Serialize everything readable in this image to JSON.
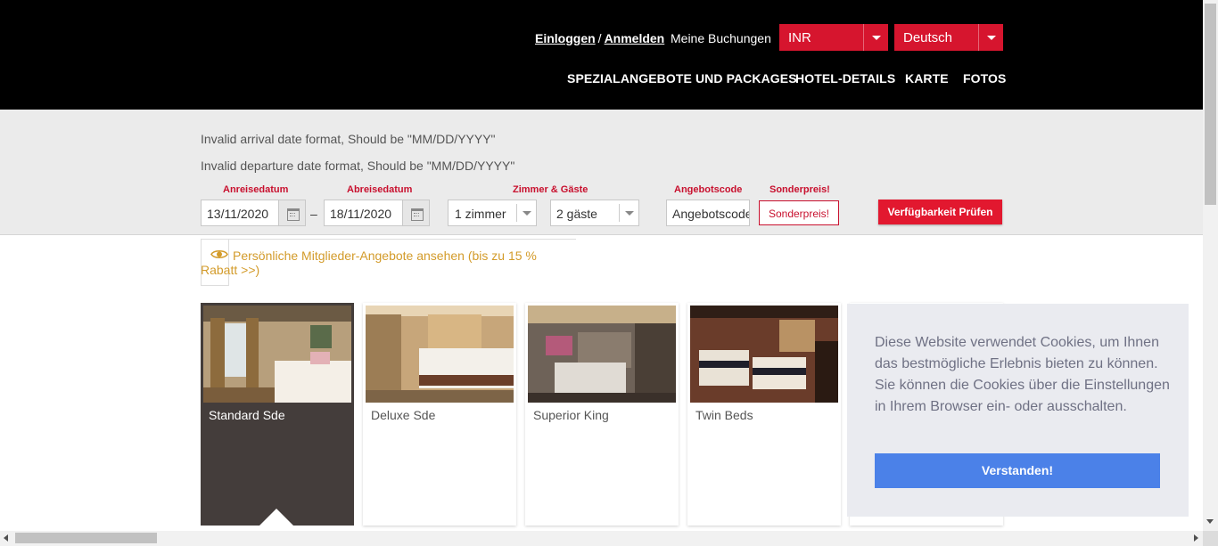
{
  "header": {
    "login": "Einloggen",
    "separator": "/",
    "register": "Anmelden",
    "bookings": "Meine Buchungen",
    "currency": "INR",
    "language": "Deutsch",
    "nav": [
      "SPEZIALANGEBOTE UND PACKAGES",
      "HOTEL-DETAILS",
      "KARTE",
      "FOTOS"
    ]
  },
  "search": {
    "errors": [
      "Invalid arrival date format, Should be \"MM/DD/YYYY\"",
      "Invalid departure date format, Should be \"MM/DD/YYYY\""
    ],
    "arrival_label": "Anreisedatum",
    "arrival_value": "13/11/2020",
    "departure_label": "Abreisedatum",
    "departure_value": "18/11/2020",
    "range_dash": "–",
    "rooms_guests_label": "Zimmer & Gäste",
    "rooms_value": "1 zimmer",
    "guests_value": "2 gäste",
    "promo_label": "Angebotscode",
    "promo_placeholder": "Angebotscode",
    "special_label": "Sonderpreis!",
    "special_button": "Sonderpreis!",
    "check_button": "Verfügbarkeit Prüfen"
  },
  "member_banner": "Persönliche Mitglieder-Angebote ansehen (bis zu 15 % Rabatt >>)",
  "rooms": [
    {
      "name": "Standard Sde",
      "active": true
    },
    {
      "name": "Deluxe Sde",
      "active": false
    },
    {
      "name": "Superior King",
      "active": false
    },
    {
      "name": "Twin Beds",
      "active": false
    }
  ],
  "cookie": {
    "text": "Diese Website verwendet Cookies, um Ihnen das bestmögliche Erlebnis bieten zu können. Sie können die Cookies über die Einstellungen in Ihrem Browser ein- oder ausschalten.",
    "button": "Verstanden!"
  },
  "colors": {
    "brand_red": "#d6152e",
    "header_bg": "#000000",
    "band_bg": "#ebebeb",
    "gold_text": "#d39b2a",
    "cookie_btn": "#4b81e8"
  }
}
